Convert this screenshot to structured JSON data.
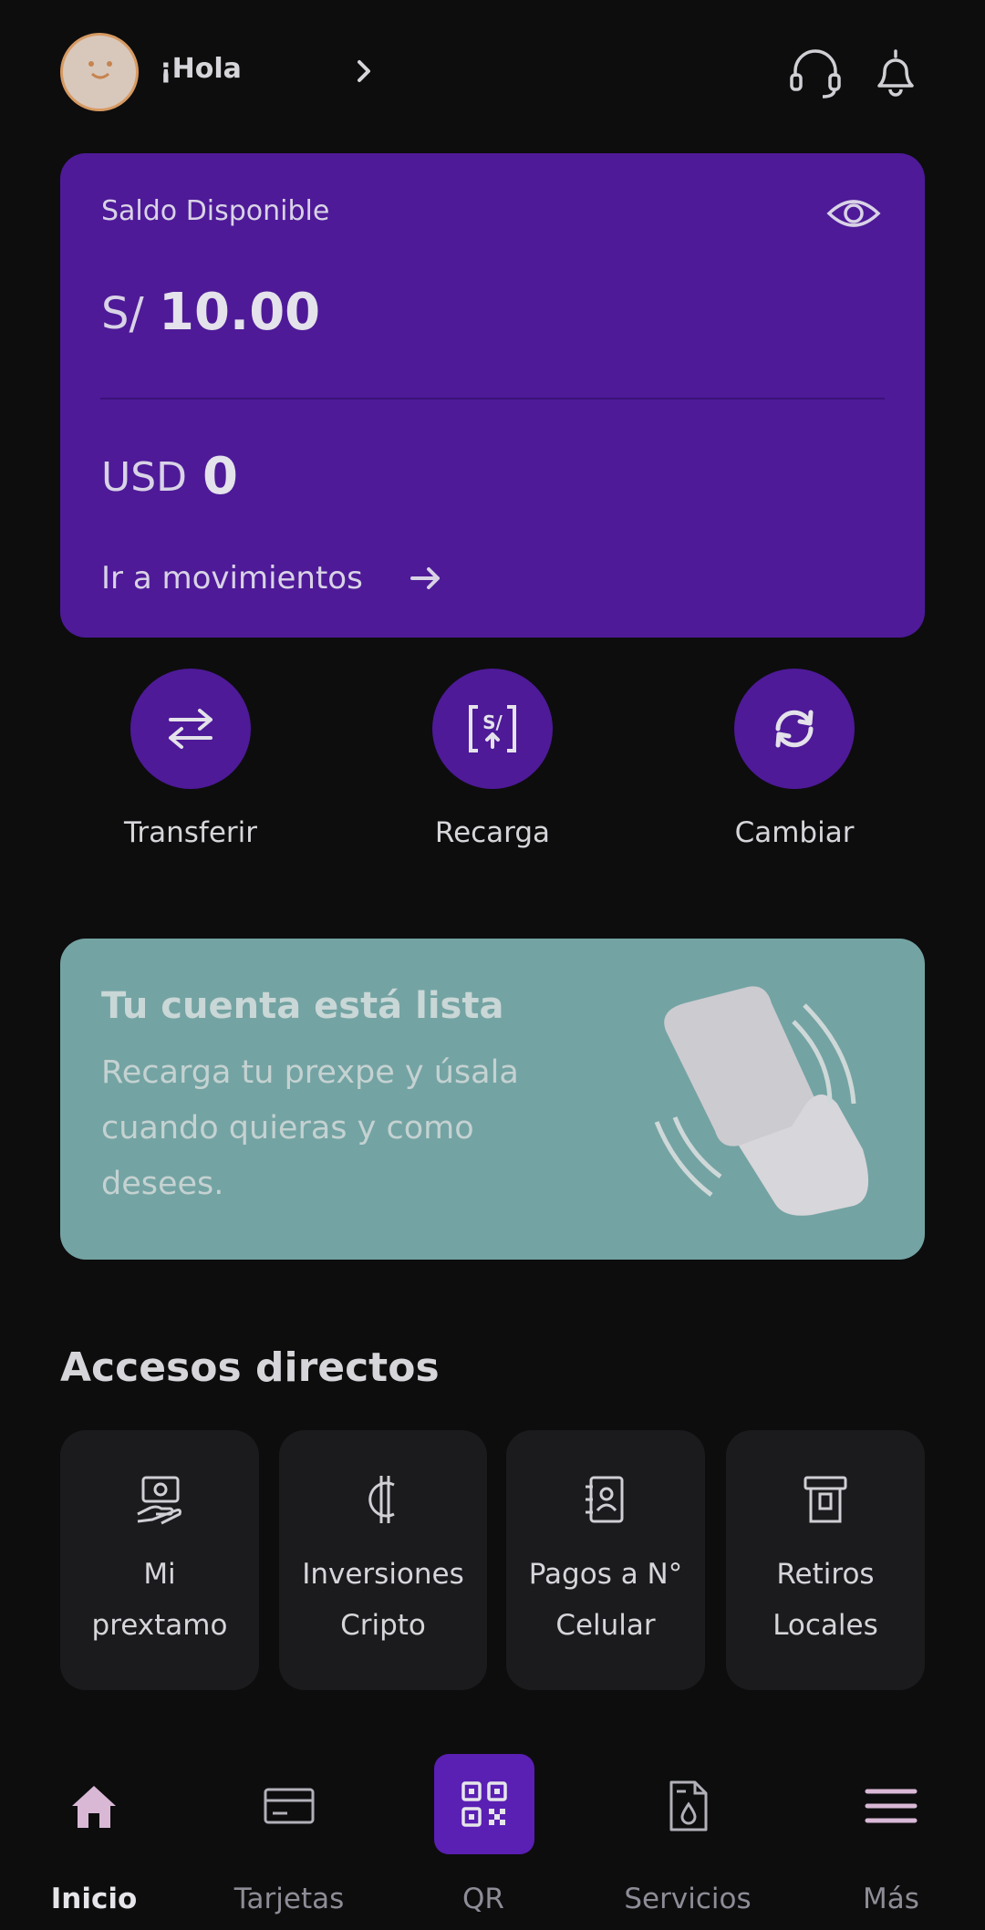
{
  "header": {
    "greeting": "¡Hola",
    "icons": {
      "avatar": "avatar-face",
      "support": "headset-icon",
      "notifications": "bell-icon"
    }
  },
  "balance_card": {
    "label": "Saldo Disponible",
    "pen_prefix": "S/",
    "pen_amount": "10.00",
    "usd_prefix": "USD",
    "usd_amount": "0",
    "movements_link": "Ir a movimientos"
  },
  "quick_actions": [
    {
      "label": "Transferir",
      "icon": "transfer-arrows-icon"
    },
    {
      "label": "Recarga",
      "icon": "soles-topup-icon"
    },
    {
      "label": "Cambiar",
      "icon": "exchange-cycle-icon"
    }
  ],
  "promo": {
    "title": "Tu cuenta está lista",
    "text": "Recarga tu prexpe y úsala cuando quieras y como desees."
  },
  "shortcuts": {
    "title": "Accesos directos",
    "items": [
      {
        "line1": "Mi",
        "line2": "prextamo",
        "icon": "loan-hand-icon"
      },
      {
        "line1": "Inversiones",
        "line2": "Cripto",
        "icon": "crypto-coin-icon"
      },
      {
        "line1": "Pagos a N°",
        "line2": "Celular",
        "icon": "contact-book-icon"
      },
      {
        "line1": "Retiros",
        "line2": "Locales",
        "icon": "atm-withdraw-icon"
      }
    ]
  },
  "bottom_nav": [
    {
      "label": "Inicio",
      "icon": "home-icon",
      "active": true
    },
    {
      "label": "Tarjetas",
      "icon": "card-icon",
      "active": false
    },
    {
      "label": "QR",
      "icon": "qr-icon",
      "active": false
    },
    {
      "label": "Servicios",
      "icon": "bill-icon",
      "active": false
    },
    {
      "label": "Más",
      "icon": "menu-icon",
      "active": false
    }
  ],
  "colors": {
    "background": "#0d0d0e",
    "accent_purple": "#4e1a98",
    "promo_teal": "#74a3a3",
    "tile": "#1b1a1d"
  }
}
